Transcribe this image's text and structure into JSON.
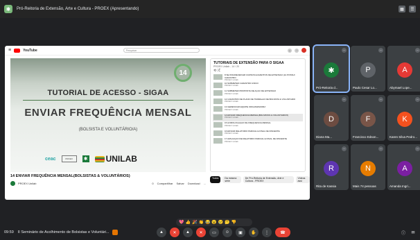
{
  "window": {
    "title": "Pró-Reitoria de Extensão, Arte e Cultura - PROEX (Apresentando)"
  },
  "youtube": {
    "brand": "YouTube",
    "search_placeholder": "Pesquisar",
    "menu": "≡"
  },
  "video": {
    "counter": "14",
    "slide_title": "TUTORIAL DE ACESSO - SIGAA",
    "slide_heading": "ENVIAR FREQUÊNCIA MENSAL",
    "slide_sub": "(BOLSISTA E VOLUNTÁRIO/A)",
    "logo_ceac": "ceac",
    "logo_proex": "PROEX",
    "logo_unilab": "UNILAB",
    "caption": "14 ENVIAR FREQUÊNCIA MENSAL(BOLSISTAS & VOLUNTÁRIOS)",
    "channel": "PROEX Unilab",
    "actions": [
      "0",
      "Compartilhar",
      "Salvar",
      "Download",
      "..."
    ]
  },
  "playlist": {
    "title": "TUTORIAIS DE EXTENSÃO PARA O SIGAA",
    "sub": "PROEX Unilab - 14 / 20",
    "items": [
      {
        "text": "8 SE INSCREVER EM CURSOS E EVENTOS DE EXTENSÃO (JÁ POSSUI CADASTRO",
        "ch": "PROEX Unilab"
      },
      {
        "text": "10 SUBMETER CADASTRO ÚNICO",
        "ch": "PROEX Unilab"
      },
      {
        "text": "11 SUBMETER PROPOSTA DE AÇÃO DE EXTENSÃO",
        "ch": "PROEX Unilab"
      },
      {
        "text": "12 CADASTRO DE PLANO DE TRABALHO DE BOLSISTA & VOLUNTÁRIO",
        "ch": "PROEX Unilab"
      },
      {
        "text": "13 GERENCIAR EQUIPE ORGANIZADORA",
        "ch": "PROEX Unilab"
      },
      {
        "text": "14 ENVIAR FREQUÊNCIA MENSAL(BOLSISTAS & VOLUNTÁRIOS)",
        "ch": "PROEX Unilab"
      },
      {
        "text": "15 HOMOLOGAÇÃO DE FREQUÊNCIA MENSAL",
        "ch": "PROEX Unilab"
      },
      {
        "text": "16 ENVIAR RELATÓRIO PARCIAL E FINAL DE DISCENTE",
        "ch": "PROEX Unilab"
      },
      {
        "text": "17 AVALIAÇÃO DE RELATÓRIO PARCIAL E FINAL DE DISCENTE",
        "ch": "PROEX Unilab"
      }
    ],
    "active_index": 5
  },
  "chips": [
    "Todos",
    "Da mesma série",
    "De Pró-Reitoria de Extensão, Arte e Cultura - PROEX",
    "Vídeos assi"
  ],
  "participants": [
    {
      "name": "Pró-Reitoria d...",
      "initial": "✱",
      "color": "#1b7a3a",
      "speaking": true
    },
    {
      "name": "Paulo Cesar Lo...",
      "initial": "P",
      "color": "#5f6368"
    },
    {
      "name": "Abymael Lope...",
      "initial": "A",
      "color": "#e53935"
    },
    {
      "name": "Diana Ma...",
      "initial": "D",
      "color": "#6d4c41"
    },
    {
      "name": "Francisco Edson...",
      "initial": "F",
      "color": "#795548"
    },
    {
      "name": "Karen Silva Pedro...",
      "initial": "K",
      "color": "#f4511e"
    },
    {
      "name": "Rita de Kassia",
      "initial": "R",
      "color": "#5e35b1"
    },
    {
      "name": "Mais 74 pessoas",
      "initial": "N",
      "color": "#e67c00"
    },
    {
      "name": "Amanda Ingri...",
      "initial": "A",
      "color": "#7b1fa2"
    }
  ],
  "bottom": {
    "time": "09:59",
    "meeting": "II Seminário de Acolhimento de Bolsistas e Voluntári..."
  },
  "reactions": [
    "💖",
    "👍",
    "🎉",
    "👏",
    "😂",
    "😮",
    "😢",
    "🤔",
    "👎"
  ]
}
